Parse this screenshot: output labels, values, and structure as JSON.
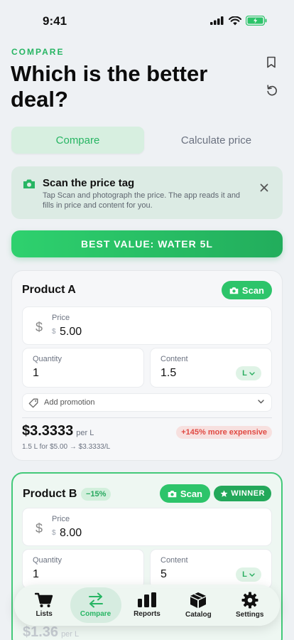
{
  "status": {
    "time": "9:41"
  },
  "header": {
    "eyebrow": "COMPARE",
    "title": "Which is the better deal?"
  },
  "segments": {
    "compare": "Compare",
    "calculate": "Calculate price"
  },
  "tip": {
    "title": "Scan the price tag",
    "text": "Tap Scan and photograph the price. The app reads it and fills in price and content for you."
  },
  "banner": "BEST VALUE: WATER 5L",
  "product_a": {
    "name": "Product A",
    "scan_label": "Scan",
    "price_label": "Price",
    "currency": "$",
    "price": "5.00",
    "quantity_label": "Quantity",
    "quantity": "1",
    "content_label": "Content",
    "content": "1.5",
    "unit": "L",
    "promo_label": "Add promotion",
    "unit_price": "$3.3333",
    "per_unit": "per L",
    "calc": "1.5 L for $5.00 → $3.3333/L",
    "comparison": "+145% more expensive"
  },
  "product_b": {
    "name": "Product B",
    "discount": "−15%",
    "scan_label": "Scan",
    "winner_label": "WINNER",
    "price_label": "Price",
    "currency": "$",
    "price": "8.00",
    "quantity_label": "Quantity",
    "quantity": "1",
    "content_label": "Content",
    "content": "5",
    "unit": "L",
    "unit_price": "$1.36",
    "per_unit": "per L"
  },
  "tabbar": {
    "lists": "Lists",
    "compare": "Compare",
    "reports": "Reports",
    "catalog": "Catalog",
    "settings": "Settings"
  },
  "colors": {
    "accent": "#2dc46a",
    "danger": "#e04a43"
  }
}
